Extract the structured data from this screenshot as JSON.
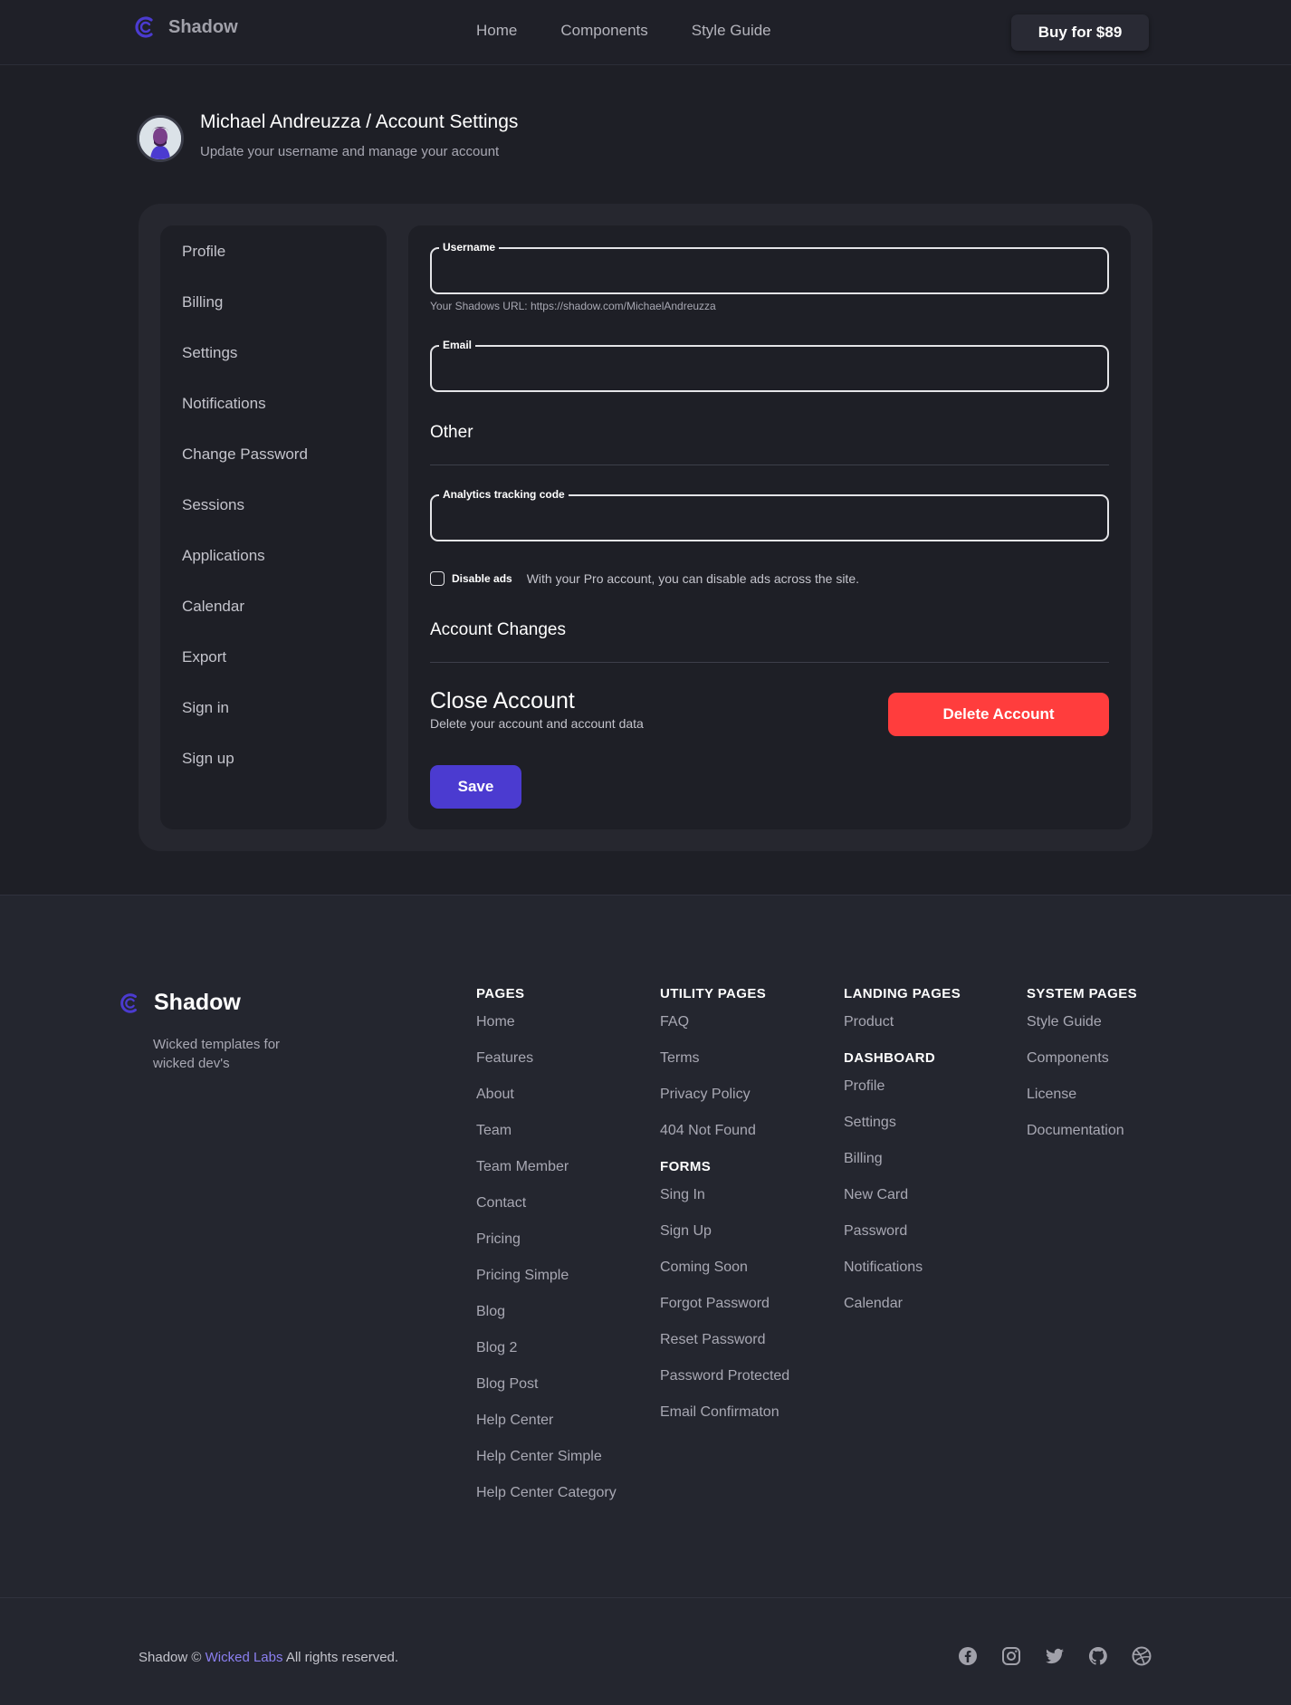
{
  "nav": {
    "brand": "Shadow",
    "links": [
      "Home",
      "Components",
      "Style Guide"
    ],
    "buy_label": "Buy for $89"
  },
  "header": {
    "title": "Michael Andreuzza / Account Settings",
    "subtitle": "Update your username and manage your account"
  },
  "sidebar": {
    "items": [
      "Profile",
      "Billing",
      "Settings",
      "Notifications",
      "Change Password",
      "Sessions",
      "Applications",
      "Calendar",
      "Export",
      "Sign in",
      "Sign up"
    ]
  },
  "form": {
    "username_label": "Username",
    "username_value": "",
    "url_hint": "Your Shadows URL: https://shadow.com/MichaelAndreuzza",
    "email_label": "Email",
    "email_value": "",
    "other_heading": "Other",
    "analytics_label": "Analytics tracking code",
    "analytics_value": "",
    "disable_ads_label": "Disable ads",
    "disable_ads_desc": "With your Pro account, you can disable ads across the site.",
    "disable_ads_checked": false,
    "account_changes_heading": "Account Changes",
    "close_title": "Close Account",
    "close_sub": "Delete your account and account data",
    "delete_label": "Delete Account",
    "save_label": "Save"
  },
  "footer": {
    "brand": "Shadow",
    "tagline": "Wicked templates for wicked dev's",
    "columns": {
      "pages": {
        "heading": "PAGES",
        "links": [
          "Home",
          "Features",
          "About",
          "Team",
          "Team Member",
          "Contact",
          "Pricing",
          "Pricing Simple",
          "Blog",
          "Blog 2",
          "Blog Post",
          "Help Center",
          "Help Center Simple",
          "Help Center Category"
        ]
      },
      "utility": {
        "heading": "UTILITY PAGES",
        "links": [
          "FAQ",
          "Terms",
          "Privacy Policy",
          "404 Not Found"
        ]
      },
      "forms": {
        "heading": "FORMS",
        "links": [
          "Sing In",
          "Sign Up",
          "Coming Soon",
          "Forgot Password",
          "Reset Password",
          "Password Protected",
          "Email Confirmaton"
        ]
      },
      "landing": {
        "heading": "LANDING PAGES",
        "links": [
          "Product"
        ]
      },
      "dashboard": {
        "heading": "DASHBOARD",
        "links": [
          "Profile",
          "Settings",
          "Billing",
          "New Card",
          "Password",
          "Notifications",
          "Calendar"
        ]
      },
      "system": {
        "heading": "SYSTEM PAGES",
        "links": [
          "Style Guide",
          "Components",
          "License",
          "Documentation"
        ]
      }
    },
    "copyright_prefix": "Shadow ©",
    "copyright_link": "Wicked Labs",
    "copyright_suffix": "All rights reserved.",
    "socials": [
      "facebook-icon",
      "instagram-icon",
      "twitter-icon",
      "github-icon",
      "dribbble-icon"
    ]
  },
  "colors": {
    "accent": "#4b3bd0",
    "danger": "#ff3d3d",
    "link": "#8b7ff0",
    "background": "#1e1f26"
  }
}
